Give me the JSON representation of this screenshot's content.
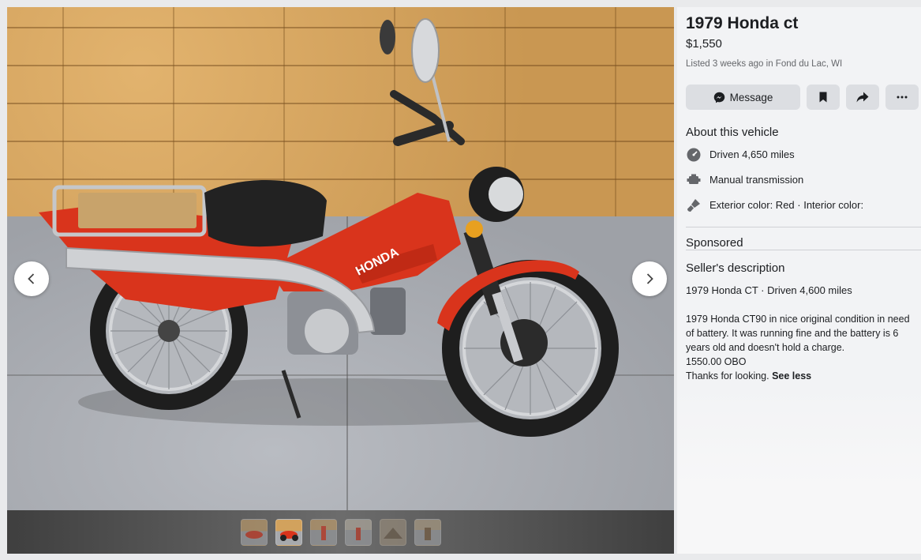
{
  "listing": {
    "title": "1979 Honda ct",
    "price": "$1,550",
    "listed": "Listed 3 weeks ago in Fond du Lac, WI"
  },
  "actions": {
    "message_label": "Message"
  },
  "about": {
    "heading": "About this vehicle",
    "specs": [
      {
        "icon": "speedometer-icon",
        "text": "Driven 4,650 miles"
      },
      {
        "icon": "engine-icon",
        "text": "Manual transmission"
      },
      {
        "icon": "paint-brush-icon",
        "text": "Exterior color: Red · Interior color:"
      }
    ]
  },
  "sponsored": {
    "heading": "Sponsored"
  },
  "description": {
    "heading": "Seller's description",
    "summary": "1979 Honda CT · Driven 4,600 miles",
    "lines": [
      "1979 Honda CT90 in nice original condition in need of battery. It was running fine and the battery is 6 years old and doesn't hold a charge.",
      "1550.00 OBO"
    ],
    "last_line": "Thanks for looking.",
    "see_less": "See less"
  },
  "viewer": {
    "thumbnail_count": 6,
    "active_thumbnail": 2
  },
  "colors": {
    "panel_bg": "#f2f3f5",
    "button_bg": "#dcdee2",
    "bike_red": "#d9341c"
  }
}
